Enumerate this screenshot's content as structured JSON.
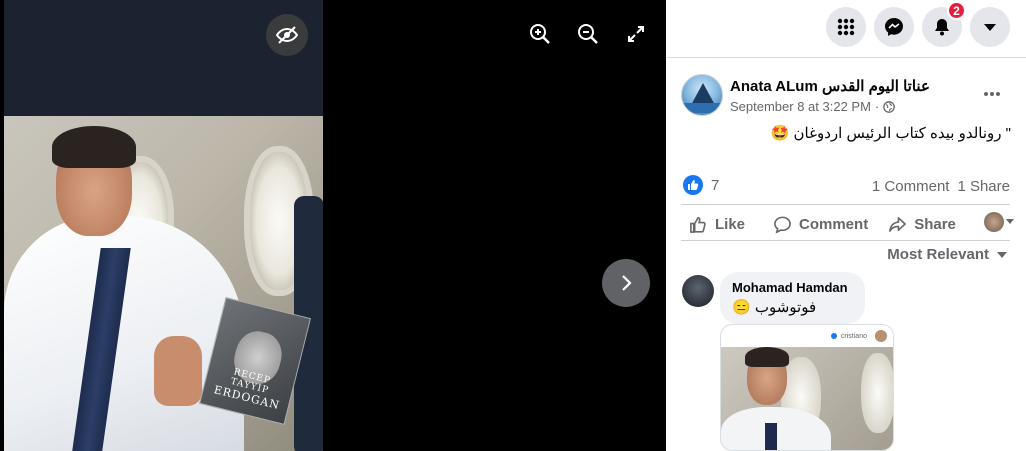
{
  "viewer": {
    "book": {
      "title_line1": "RECEP TAYYIP",
      "title_line2": "ERDOGAN"
    },
    "controls": [
      "eye-off-icon",
      "zoom-in-icon",
      "zoom-out-icon",
      "expand-icon",
      "chevron-right-icon"
    ]
  },
  "topbar": {
    "buttons": [
      "menu-grid-icon",
      "messenger-icon",
      "notifications-bell-icon",
      "account-caret-icon"
    ],
    "notifications_badge": "2"
  },
  "post": {
    "author": "Anata ALum عناتا اليوم القدس",
    "date": "September 8 at 3:22 PM",
    "separator": "·",
    "audience_icon": "globe-icon",
    "text": "\" رونالدو بيده كتاب الرئيس اردوغان 🤩",
    "reactions_count": "7",
    "comments_count": "1 Comment",
    "shares_count": "1 Share",
    "actions": {
      "like": "Like",
      "comment": "Comment",
      "share": "Share"
    },
    "sort_label": "Most Relevant"
  },
  "comment": {
    "author": "Mohamad Hamdan",
    "text": "فوتوشوب 😑",
    "image_header": "cristiano"
  },
  "colors": {
    "accent": "#1877f2",
    "badge": "#e41e3f",
    "muted": "#65676b"
  }
}
